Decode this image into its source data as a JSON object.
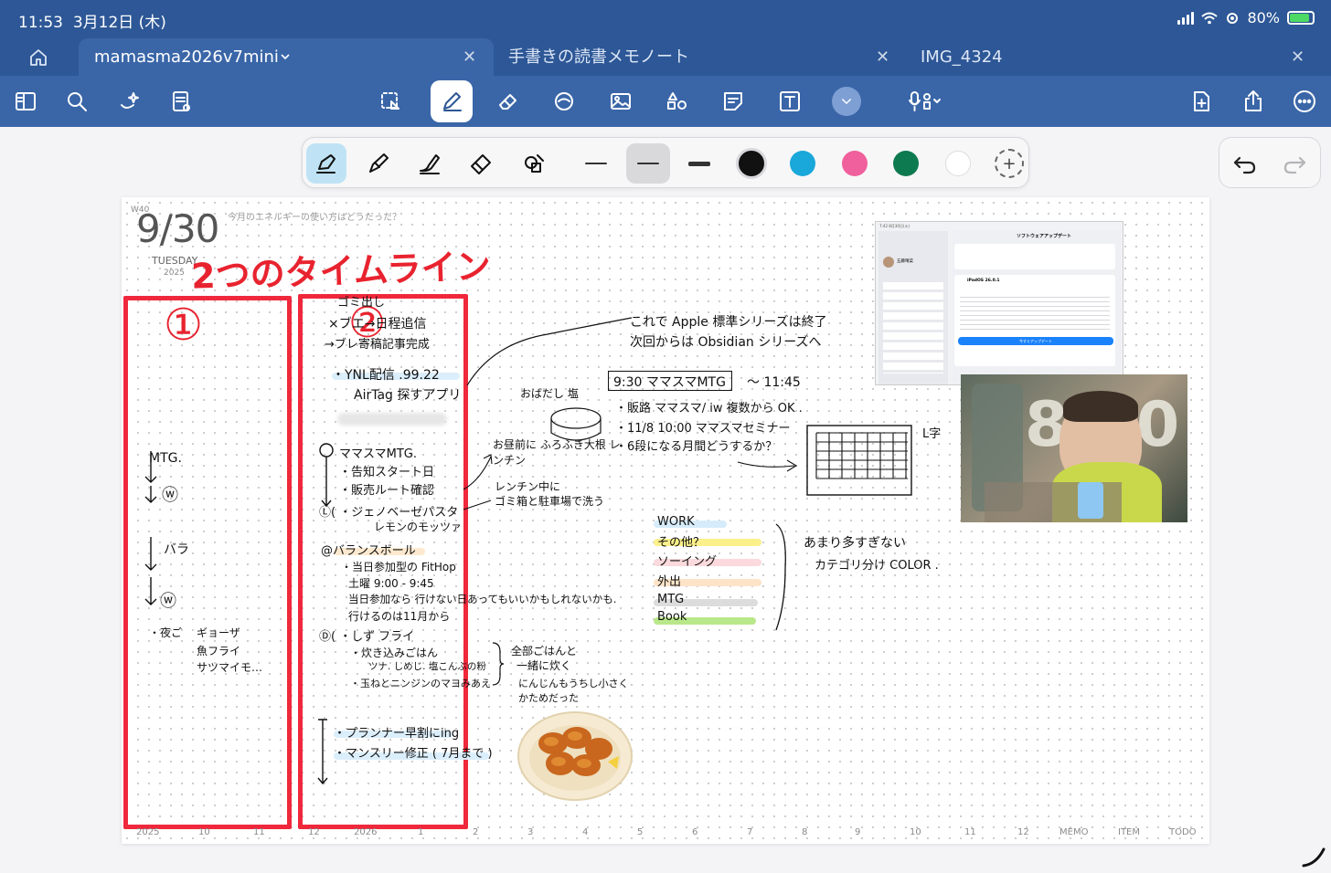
{
  "status": {
    "time": "11:53",
    "date": "3月12日 (木)",
    "battery": "80%"
  },
  "tabs": [
    {
      "label": "mamasma2026v7mini",
      "active": true
    },
    {
      "label": "手書きの読書メモノート",
      "active": false
    },
    {
      "label": "IMG_4324",
      "active": false
    }
  ],
  "toolbar_icons": [
    "sidebar-icon",
    "search-icon",
    "magic-icon",
    "document-icon",
    "lasso-icon",
    "pen-icon",
    "eraser-icon",
    "shape-icon",
    "image-icon",
    "elements-icon",
    "sticky-note-icon",
    "text-box-icon",
    "chevron-down-icon",
    "mic-icon",
    "add-page-icon",
    "share-icon",
    "more-icon"
  ],
  "pen_colors": [
    "#111111",
    "#1aa7d9",
    "#f0609c",
    "#0e7a4f",
    "#ffffff"
  ],
  "page": {
    "week": "W40",
    "date": "9/30",
    "weekday": "TUESDAY",
    "year": "2025",
    "prompt": "今月のエネルギーの使い方はどうだった？",
    "footer": [
      "2025",
      "10",
      "11",
      "12",
      "2026",
      "1",
      "2",
      "3",
      "4",
      "5",
      "6",
      "7",
      "8",
      "9",
      "10",
      "11",
      "12",
      "MEMO",
      "ITEM",
      "TODO"
    ]
  },
  "notes": {
    "title": "2つのタイムライン",
    "num1": "①",
    "num2": "②",
    "left": {
      "mtg": "MTG.",
      "w1": "ⓦ",
      "bara": "バラ",
      "w2": "ⓦ",
      "dinner_label": "・夜ご",
      "dinner1": "ギョーザ",
      "dinner2": "魚フライ",
      "dinner3": "サツマイモ…"
    },
    "middle": {
      "l1": "ゴミ出し",
      "l2": "×ブエ→日程追信",
      "l3": "→ブレ寄稿記事完成",
      "l4": "・YNL配信 .99.22",
      "l5": "AirTag 探すアプリ",
      "l6": "ママスマMTG.",
      "l7": "・告知スタート日",
      "l8": "・販売ルート確認",
      "l9": "Ⓛ( ・ジェノベーゼパスタ",
      "l10": "レモンのモッツァ",
      "l11": "@バランスボール",
      "l12": "・当日参加型の FitHop",
      "l13": "土曜 9:00 - 9:45",
      "l14": "当日参加なら 行けない日あってもいいかもしれないかも.",
      "l15": "行けるのは11月から",
      "l16": "Ⓓ( ・しず フライ",
      "l17": "・炊き込みごはん",
      "l18": "ツナ. しめじ. 塩こんぶの粉",
      "l19": "・玉ねとニンジンのマヨみあえ",
      "l20": "・プランナー早割にing",
      "l21": "・マンスリー修正 ( 7月まで )"
    },
    "right": {
      "r1": "これで Apple 標準シリーズは終了",
      "r2": "次回からは Obsidian シリーズへ",
      "r3": "おばだし 塩",
      "r4": "お昼前に ふろふき大根 レンチン",
      "r5": "レンチン中に",
      "r6": "ゴミ箱と駐車場で洗う",
      "r7": "9:30 ママスマMTG",
      "r8": "〜 11:45",
      "r9": "・販路 ママスマ/ iw 複数から OK .",
      "r10": "・11/8 10:00 ママスマセミナー",
      "r11": "・6段になる月間どうするか？",
      "r12": "L字",
      "r13": "全部ごはんと",
      "r14": "一緒に炊く",
      "r15": "にんじんもうちし小さく",
      "r16": "かためだった",
      "c1": "WORK",
      "c2": "その他？",
      "c3": "ソーイング",
      "c4": "外出",
      "c5": "MTG",
      "c6": "Book",
      "r17": "あまり多すぎない",
      "r18": "カテゴリ分け COLOR ."
    },
    "screenshot": {
      "time": "7:42 8月30日(火)",
      "title": "ソフトウェアアップデート",
      "version": "iPadOS 26.0.1",
      "user": "五藤晴菜",
      "button": "今すぐアップデート"
    },
    "photo": {
      "clock": "8:30"
    }
  }
}
